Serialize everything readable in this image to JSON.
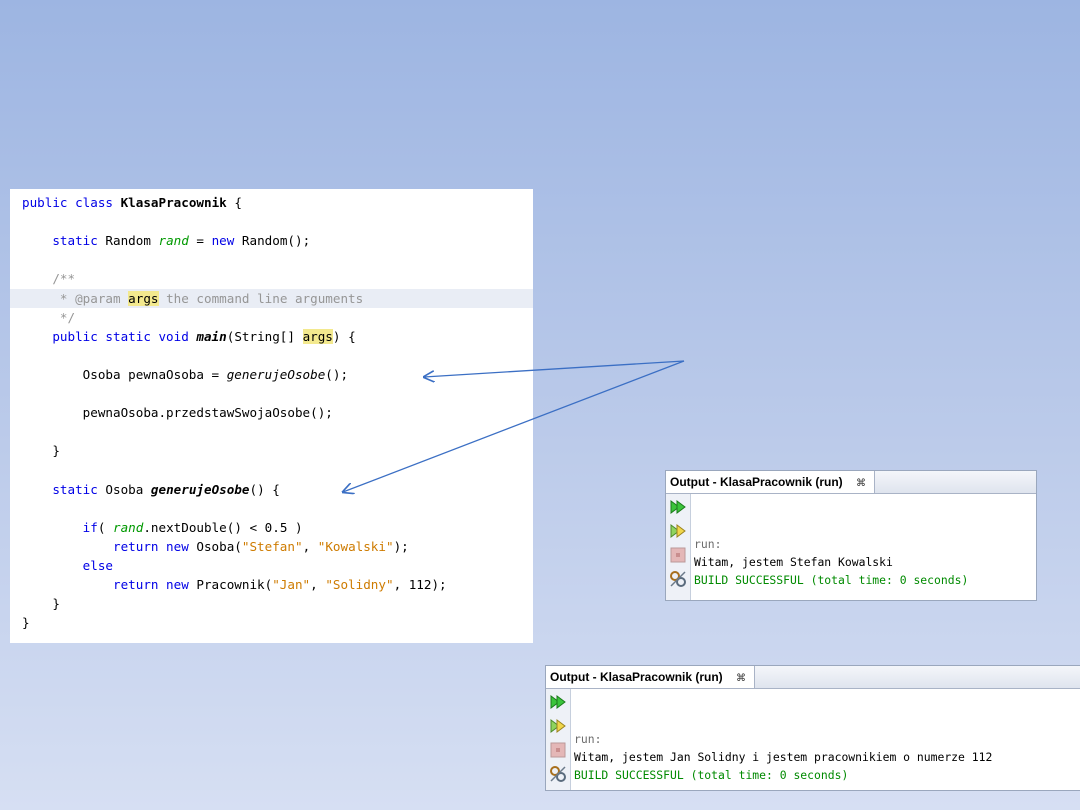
{
  "code_editor": {
    "lines": [
      {
        "segments": [
          {
            "t": "public class ",
            "c": "kw"
          },
          {
            "t": "KlasaPracownik",
            "c": "meth"
          },
          {
            "t": " {",
            "c": ""
          }
        ]
      },
      {
        "segments": []
      },
      {
        "segments": [
          {
            "t": "    static ",
            "c": "kw"
          },
          {
            "t": "Random ",
            "c": ""
          },
          {
            "t": "rand",
            "c": "fld"
          },
          {
            "t": " = ",
            "c": ""
          },
          {
            "t": "new ",
            "c": "kw"
          },
          {
            "t": "Random();",
            "c": ""
          }
        ]
      },
      {
        "segments": []
      },
      {
        "segments": [
          {
            "t": "    /**",
            "c": "cmt"
          }
        ]
      },
      {
        "segments": [
          {
            "t": "     * @param ",
            "c": "cmt"
          },
          {
            "t": "args",
            "c": "mark"
          },
          {
            "t": " the command line arguments",
            "c": "cmt"
          }
        ],
        "highlight": true
      },
      {
        "segments": [
          {
            "t": "     */",
            "c": "cmt"
          }
        ]
      },
      {
        "segments": [
          {
            "t": "    public static void ",
            "c": "kw"
          },
          {
            "t": "main",
            "c": "meth ital"
          },
          {
            "t": "(String[] ",
            "c": ""
          },
          {
            "t": "args",
            "c": "mark"
          },
          {
            "t": ") {",
            "c": ""
          }
        ]
      },
      {
        "segments": []
      },
      {
        "segments": [
          {
            "t": "        Osoba pewnaOsoba = ",
            "c": ""
          },
          {
            "t": "generujeOsobe",
            "c": "ital"
          },
          {
            "t": "();",
            "c": ""
          }
        ]
      },
      {
        "segments": []
      },
      {
        "segments": [
          {
            "t": "        pewnaOsoba.przedstawSwojaOsobe();",
            "c": ""
          }
        ]
      },
      {
        "segments": []
      },
      {
        "segments": [
          {
            "t": "    }",
            "c": ""
          }
        ]
      },
      {
        "segments": []
      },
      {
        "segments": [
          {
            "t": "    static ",
            "c": "kw"
          },
          {
            "t": "Osoba ",
            "c": ""
          },
          {
            "t": "generujeOsobe",
            "c": "meth ital"
          },
          {
            "t": "() {",
            "c": ""
          }
        ]
      },
      {
        "segments": []
      },
      {
        "segments": [
          {
            "t": "        if",
            "c": "kw"
          },
          {
            "t": "( ",
            "c": ""
          },
          {
            "t": "rand",
            "c": "fld"
          },
          {
            "t": ".nextDouble() < 0.5 )",
            "c": ""
          }
        ]
      },
      {
        "segments": [
          {
            "t": "            return new ",
            "c": "kw"
          },
          {
            "t": "Osoba(",
            "c": ""
          },
          {
            "t": "\"Stefan\"",
            "c": "str"
          },
          {
            "t": ", ",
            "c": ""
          },
          {
            "t": "\"Kowalski\"",
            "c": "str"
          },
          {
            "t": ");",
            "c": ""
          }
        ]
      },
      {
        "segments": [
          {
            "t": "        else",
            "c": "kw"
          }
        ]
      },
      {
        "segments": [
          {
            "t": "            return new ",
            "c": "kw"
          },
          {
            "t": "Pracownik(",
            "c": ""
          },
          {
            "t": "\"Jan\"",
            "c": "str"
          },
          {
            "t": ", ",
            "c": ""
          },
          {
            "t": "\"Solidny\"",
            "c": "str"
          },
          {
            "t": ", 112);",
            "c": ""
          }
        ]
      },
      {
        "segments": [
          {
            "t": "    }",
            "c": ""
          }
        ]
      },
      {
        "segments": [
          {
            "t": "}",
            "c": ""
          }
        ]
      }
    ]
  },
  "output_1": {
    "tab_title": "Output - KlasaPracownik (run)",
    "close_glyph": "⌘",
    "lines": [
      {
        "text": "run:",
        "c": "o-run"
      },
      {
        "text": "Witam, jestem Stefan Kowalski",
        "c": "o-txt"
      },
      {
        "text": "BUILD SUCCESSFUL (total time: 0 seconds)",
        "c": "o-ok"
      }
    ]
  },
  "output_2": {
    "tab_title": "Output - KlasaPracownik (run)",
    "close_glyph": "⌘",
    "lines": [
      {
        "text": "run:",
        "c": "o-run"
      },
      {
        "text": "Witam, jestem Jan Solidny i jestem pracownikiem o numerze 112",
        "c": "o-txt"
      },
      {
        "text": "BUILD SUCCESSFUL (total time: 0 seconds)",
        "c": "o-ok"
      }
    ]
  },
  "side_icons": [
    "rerun-icon",
    "rerun-with-args-icon",
    "stop-icon",
    "settings-icon"
  ],
  "colors": {
    "keyword": "#0000e6",
    "string": "#ce7b00",
    "comment": "#969696",
    "field": "#009900",
    "build_success": "#008a00",
    "arrow": "#3b6fc4"
  }
}
